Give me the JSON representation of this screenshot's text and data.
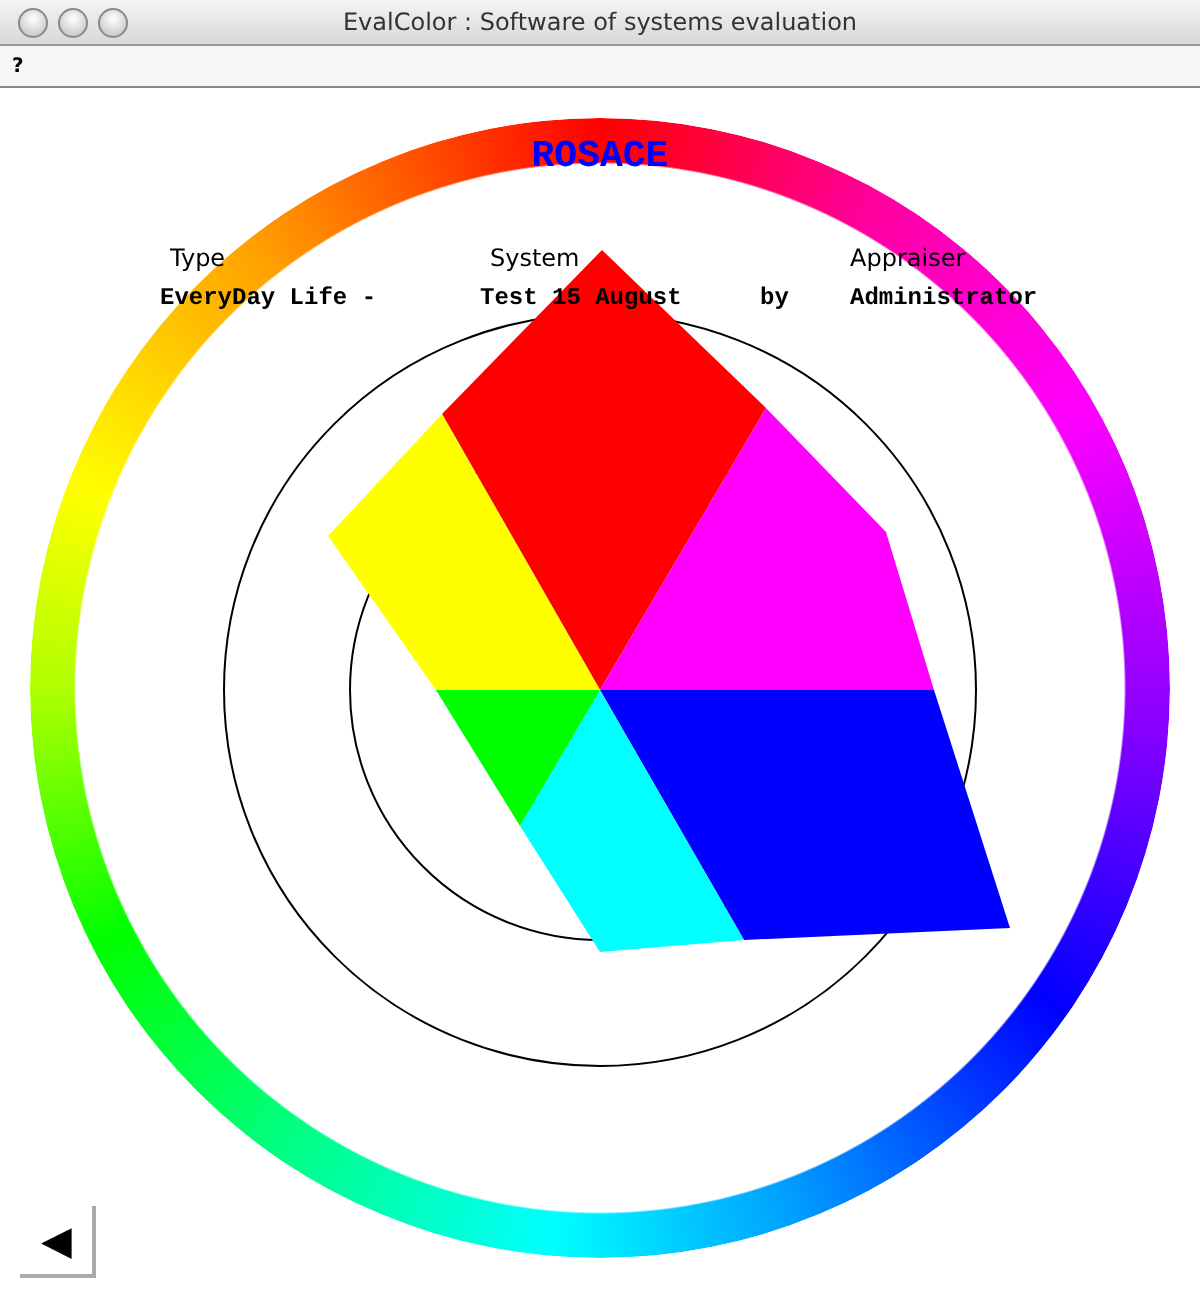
{
  "window": {
    "title": "EvalColor : Software of systems evaluation"
  },
  "menu": [
    "?"
  ],
  "rosace": {
    "title": "ROSACE",
    "labels": [
      "Type",
      "System",
      "Appraiser"
    ],
    "values": [
      "EveryDay Life -",
      "Test 15 August",
      "by",
      "Administrator"
    ]
  },
  "back_button": {
    "label": "◀"
  }
}
